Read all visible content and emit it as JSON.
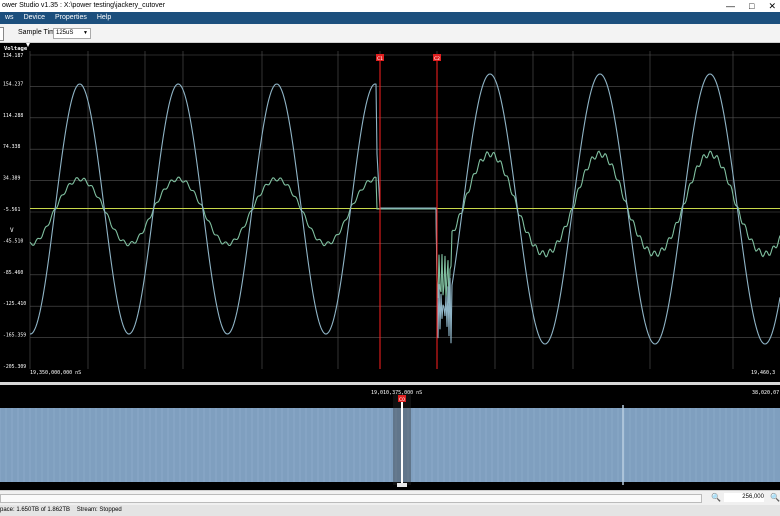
{
  "window": {
    "title": "ower Studio v1.35 : X:\\power testing\\jackery_cutover"
  },
  "menu": {
    "items": [
      "ws",
      "Device",
      "Properties",
      "Help"
    ]
  },
  "toolbar": {
    "sample_time_label": "Sample Time:",
    "sample_time_value": "125uS"
  },
  "colors": {
    "plot_bg": "#000000",
    "voltage": "#8fb4c6",
    "current": "#7fbf9f",
    "flat": "#c8d84a",
    "cursor": "#ff2020",
    "overview_fill": "#7f9fbf"
  },
  "plot": {
    "channel": "Voltage",
    "unit": "V",
    "y_ticks": [
      "134.187",
      "154.237",
      "114.288",
      "74.338",
      "34.389",
      "-5.561",
      "-45.510",
      "-85.460",
      "-125.410",
      "-165.359",
      "-205.309"
    ],
    "x_left_label": "19,350,000,000 nS",
    "x_right_label": "19,460,3",
    "cursor1_label": "C1",
    "cursor2_label": "C2"
  },
  "overview": {
    "center_label": "19,010,375,000 nS",
    "right_label": "38,020,07",
    "cursor_label": "C0"
  },
  "zoom": {
    "value": "256,000"
  },
  "status": {
    "space_text": "pace: 1.650TB of 1.862TB",
    "stream_text": "Stream:  Stopped"
  }
}
